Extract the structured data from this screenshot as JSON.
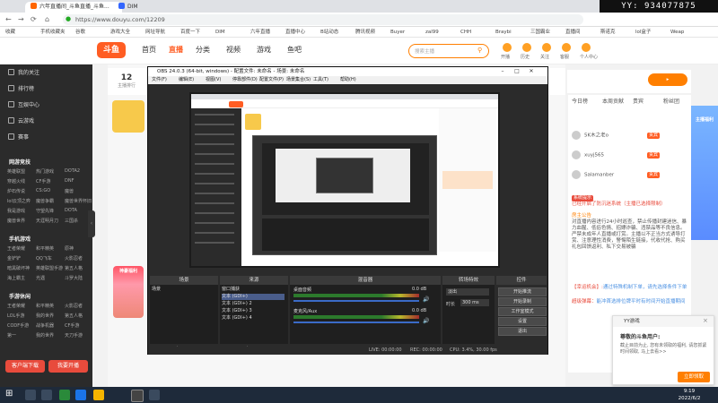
{
  "browser": {
    "tabs": [
      {
        "label": "六年直播间_斗鱼直播_斗鱼..."
      },
      {
        "label": "DIM"
      }
    ],
    "url": "https://www.douyu.com/12209",
    "bookmarks": [
      "收藏",
      "手机收藏夹",
      "谷歌",
      "游戏大全",
      "网址导航",
      "百度一下",
      "DIM",
      "六年直播",
      "直播中心",
      "B站动态",
      "腾讯视频",
      "Buyer",
      "zal99",
      "CHH",
      "Braybi",
      "三国霸业",
      "直播间",
      "斯诺克",
      "lol盒子",
      "Weap"
    ]
  },
  "watermark": "YY: 934077875",
  "site": {
    "logo": "斗鱼",
    "nav": [
      "首页",
      "直播",
      "分类",
      "视频",
      "游戏",
      "鱼吧"
    ],
    "nav_active": 1,
    "search_placeholder": "搜索主播",
    "header_icons": [
      "开播",
      "历史",
      "关注",
      "客服",
      "个人中心"
    ]
  },
  "sidebar": {
    "top_items": [
      "我的关注",
      "排行榜",
      "互娱中心",
      "云游戏",
      "赛事"
    ],
    "groups": [
      {
        "title": "网游竞技",
        "games": [
          "英雄联盟",
          "热门游戏",
          "DOTA2",
          "穿越火线",
          "CF手游",
          "DNF",
          "炉石传说",
          "CS:GO",
          "魔兽",
          "lol云顶之弈",
          "魔兽争霸",
          "魔兽世界怀旧",
          "我是游戏",
          "守望先锋",
          "DOTA",
          "魔兽世界",
          "天涯明月刀",
          "三国杀"
        ]
      },
      {
        "title": "手机游戏",
        "games": [
          "王者荣耀",
          "和平精英",
          "原神",
          "金铲铲",
          "QQ飞车",
          "火影忍者",
          "暗黑破坏神",
          "英雄联盟手游",
          "第五人格",
          "海上霸主",
          "光遇",
          "斗罗大陆"
        ]
      },
      {
        "title": "手游休闲",
        "games": [
          "王者荣耀",
          "和平精英",
          "火影忍者",
          "LOL手游",
          "我的世界",
          "第五人格",
          "CODF手游",
          "战争机器",
          "CF手游",
          "第一",
          "我的世界",
          "天刀手游"
        ]
      }
    ],
    "bottom_buttons": [
      "客户端下载",
      "我要开播"
    ]
  },
  "room": {
    "rank_number": "12",
    "rank_label": "主播排行",
    "gift_label": "神豪福利"
  },
  "obs": {
    "title": "OBS 24.0.3 (64-bit, windows) - 配置文件: 未命名 - 场景: 未命名",
    "menu": [
      "文件(F)",
      "编辑(E)",
      "视图(V)",
      "停靠部件(D)",
      "配置文件(P)",
      "场景集合(S)",
      "工具(T)",
      "帮助(H)"
    ],
    "panels": {
      "scenes": {
        "title": "场景",
        "items": [
          "场景"
        ]
      },
      "sources": {
        "title": "来源",
        "items": [
          "窗口捕获",
          "文本 (GDI+)",
          "文本 (GDI+) 2",
          "文本 (GDI+) 3",
          "文本 (GDI+) 4"
        ],
        "selected_index": 1
      },
      "mixer": {
        "title": "混音器",
        "channels": [
          {
            "name": "桌面音频",
            "db": "0.0 dB"
          },
          {
            "name": "麦克风/Aux",
            "db": "0.0 dB"
          }
        ]
      },
      "transitions": {
        "title": "转场特效",
        "mode": "淡出",
        "duration_label": "时长",
        "duration": "300 ms"
      },
      "controls": {
        "title": "控件",
        "buttons": [
          "开始推流",
          "开始录制",
          "工作室模式",
          "设置",
          "退出"
        ]
      }
    },
    "status": {
      "live": "LIVE: 00:00:00",
      "rec": "REC: 00:00:00",
      "cpu": "CPU: 3.4%, 30.00 fps"
    }
  },
  "chat": {
    "tabs": [
      "今日榜",
      "本周贡献",
      "贵宾",
      "粉丝团"
    ],
    "users": [
      {
        "name": "5K木之老o",
        "tag": "贵宾"
      },
      {
        "name": "xuyj565",
        "tag": "贵宾"
      },
      {
        "name": "Salamanber",
        "tag": "贵宾"
      }
    ],
    "notice_title": "系统提示",
    "notice": "已经开启了防沉迷系统（主播已选择限制）",
    "announcement_name": "房主公告",
    "announcement": "对直播内容进行24小时巡查，禁止传播封建迷信、暴力血腥、低俗色情、招嫖诈骗、违禁品等不良信息。严禁未成年人直播或打赏。主播以不正当方式诱导打赏、注意理性消费，警惕陌生链接，代收代抢、购买礼包回馈返利、私下交易被骗",
    "messages": [
      {
        "user": "【幸运机会】:",
        "text": "通过特殊机制下单，请先选择条件下单"
      },
      {
        "user": "超级弹幕：",
        "text": "能冲首选排位牌平时有时间开始直播期间"
      }
    ],
    "ad_label": "主播福利"
  },
  "popup": {
    "title": "YY游戏",
    "heading": "尊敬的斗鱼用户:",
    "text": "截止目前为止, 您有未领取的福利, 请您抓紧时间领取, 马上去看>>",
    "button": "立即领取"
  },
  "taskbar": {
    "time": "9:19",
    "date": "2022/6/2"
  },
  "colors": {
    "brand": "#ff5d23",
    "accent": "#ff7f00",
    "sidebar_bg": "#2b2b2b",
    "obs_bg": "#2b2b2b"
  }
}
